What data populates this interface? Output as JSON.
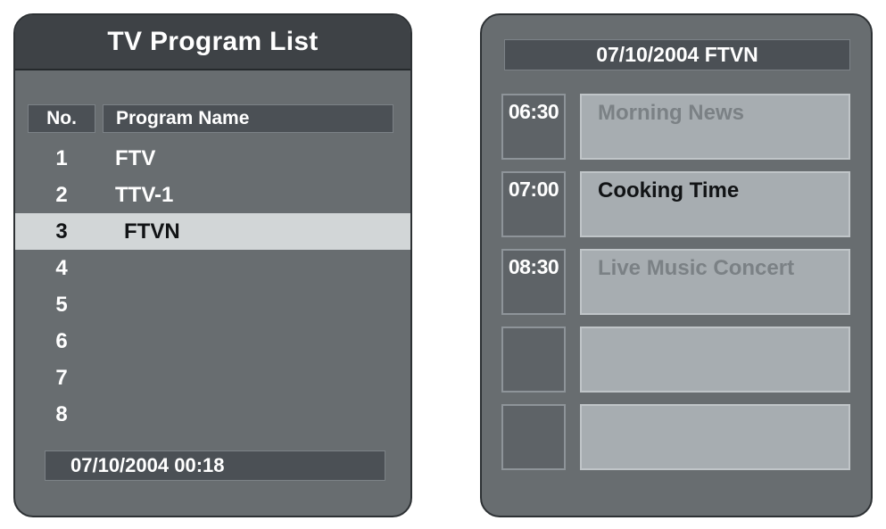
{
  "left_panel": {
    "title": "TV Program List",
    "columns": {
      "no": "No.",
      "name": "Program Name"
    },
    "rows": [
      {
        "no": "1",
        "name": "FTV",
        "selected": false
      },
      {
        "no": "2",
        "name": "TTV-1",
        "selected": false
      },
      {
        "no": "3",
        "name": "FTVN",
        "selected": true
      },
      {
        "no": "4",
        "name": "",
        "selected": false
      },
      {
        "no": "5",
        "name": "",
        "selected": false
      },
      {
        "no": "6",
        "name": "",
        "selected": false
      },
      {
        "no": "7",
        "name": "",
        "selected": false
      },
      {
        "no": "8",
        "name": "",
        "selected": false
      }
    ],
    "status": "07/10/2004 00:18"
  },
  "right_panel": {
    "header": "07/10/2004 FTVN",
    "schedule": [
      {
        "time": "06:30",
        "program": "Morning News",
        "dimmed": true
      },
      {
        "time": "07:00",
        "program": "Cooking Time",
        "dimmed": false
      },
      {
        "time": "08:30",
        "program": "Live Music Concert",
        "dimmed": true
      },
      {
        "time": "",
        "program": "",
        "dimmed": false
      },
      {
        "time": "",
        "program": "",
        "dimmed": false
      }
    ]
  },
  "colors": {
    "panel_background": "#686d70",
    "panel_border": "#2d3134",
    "titlebar_background": "#3e4246",
    "header_cell_background": "#4b5055",
    "header_cell_border": "#7c8287",
    "selected_row_background": "#d2d6d7",
    "program_box_background": "#a7adb1",
    "program_box_border": "#c0c5c8",
    "time_box_background": "#5e6367",
    "time_box_border": "#8e9499",
    "text_light": "#ffffff",
    "text_dark": "#111315",
    "text_dimmed": "#7b8185"
  }
}
